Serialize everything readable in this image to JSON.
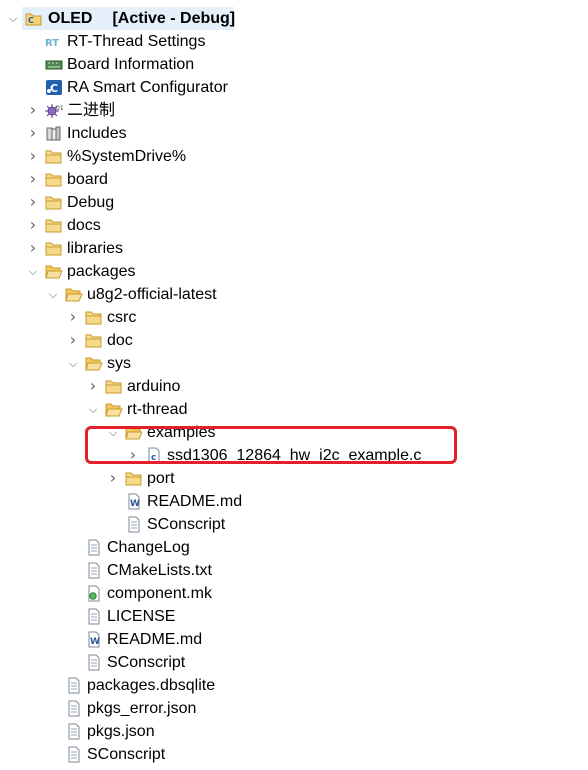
{
  "root": {
    "name": "OLED",
    "status": "[Active - Debug]",
    "expanded": true
  },
  "tree": [
    {
      "id": "rt-thread-settings",
      "label": "RT-Thread Settings",
      "depth": 1,
      "kind": "rt-settings",
      "toggle": "none"
    },
    {
      "id": "board-information",
      "label": "Board Information",
      "depth": 1,
      "kind": "board-info",
      "toggle": "none"
    },
    {
      "id": "ra-smart-configurator",
      "label": "RA Smart Configurator",
      "depth": 1,
      "kind": "ra-config",
      "toggle": "none"
    },
    {
      "id": "binaries",
      "label": "二进制",
      "depth": 1,
      "kind": "binaries",
      "toggle": "collapsed"
    },
    {
      "id": "includes",
      "label": "Includes",
      "depth": 1,
      "kind": "includes",
      "toggle": "collapsed"
    },
    {
      "id": "systemdrive",
      "label": "%SystemDrive%",
      "depth": 1,
      "kind": "folder",
      "toggle": "collapsed"
    },
    {
      "id": "board",
      "label": "board",
      "depth": 1,
      "kind": "folder",
      "toggle": "collapsed"
    },
    {
      "id": "debug",
      "label": "Debug",
      "depth": 1,
      "kind": "folder",
      "toggle": "collapsed"
    },
    {
      "id": "docs",
      "label": "docs",
      "depth": 1,
      "kind": "folder",
      "toggle": "collapsed"
    },
    {
      "id": "libraries",
      "label": "libraries",
      "depth": 1,
      "kind": "folder",
      "toggle": "collapsed"
    },
    {
      "id": "packages",
      "label": "packages",
      "depth": 1,
      "kind": "folder-open",
      "toggle": "expanded"
    },
    {
      "id": "u8g2",
      "label": "u8g2-official-latest",
      "depth": 2,
      "kind": "folder-open",
      "toggle": "expanded"
    },
    {
      "id": "csrc",
      "label": "csrc",
      "depth": 3,
      "kind": "folder",
      "toggle": "collapsed"
    },
    {
      "id": "doc",
      "label": "doc",
      "depth": 3,
      "kind": "folder",
      "toggle": "collapsed"
    },
    {
      "id": "sys",
      "label": "sys",
      "depth": 3,
      "kind": "folder-open",
      "toggle": "expanded"
    },
    {
      "id": "arduino",
      "label": "arduino",
      "depth": 4,
      "kind": "folder",
      "toggle": "collapsed"
    },
    {
      "id": "rt-thread",
      "label": "rt-thread",
      "depth": 4,
      "kind": "folder-open",
      "toggle": "expanded"
    },
    {
      "id": "examples",
      "label": "examples",
      "depth": 5,
      "kind": "folder-open",
      "toggle": "expanded"
    },
    {
      "id": "ssd1306-example",
      "label": "ssd1306_12864_hw_i2c_example.c",
      "depth": 6,
      "kind": "c-file",
      "toggle": "collapsed"
    },
    {
      "id": "port",
      "label": "port",
      "depth": 5,
      "kind": "folder",
      "toggle": "collapsed"
    },
    {
      "id": "readme-rt",
      "label": "README.md",
      "depth": 5,
      "kind": "word-file",
      "toggle": "none"
    },
    {
      "id": "sconscript-rt",
      "label": "SConscript",
      "depth": 5,
      "kind": "text-file",
      "toggle": "none"
    },
    {
      "id": "changelog",
      "label": "ChangeLog",
      "depth": 3,
      "kind": "text-file",
      "toggle": "none"
    },
    {
      "id": "cmakelists",
      "label": "CMakeLists.txt",
      "depth": 3,
      "kind": "text-file",
      "toggle": "none"
    },
    {
      "id": "component-mk",
      "label": "component.mk",
      "depth": 3,
      "kind": "mk-file",
      "toggle": "none"
    },
    {
      "id": "license",
      "label": "LICENSE",
      "depth": 3,
      "kind": "text-file",
      "toggle": "none"
    },
    {
      "id": "readme-u8g2",
      "label": "README.md",
      "depth": 3,
      "kind": "word-file",
      "toggle": "none"
    },
    {
      "id": "sconscript-u8g2",
      "label": "SConscript",
      "depth": 3,
      "kind": "text-file",
      "toggle": "none"
    },
    {
      "id": "packages-dbsqlite",
      "label": "packages.dbsqlite",
      "depth": 2,
      "kind": "text-file",
      "toggle": "none"
    },
    {
      "id": "pkgs-error-json",
      "label": "pkgs_error.json",
      "depth": 2,
      "kind": "text-file",
      "toggle": "none"
    },
    {
      "id": "pkgs-json",
      "label": "pkgs.json",
      "depth": 2,
      "kind": "text-file",
      "toggle": "none"
    },
    {
      "id": "sconscript-pkgs",
      "label": "SConscript",
      "depth": 2,
      "kind": "text-file",
      "toggle": "none"
    }
  ],
  "highlight": {
    "color": "#e3202a",
    "items": [
      "examples",
      "ssd1306-example"
    ]
  },
  "colors": {
    "folder": "#e9b949",
    "selection": "#e5f0fb"
  }
}
